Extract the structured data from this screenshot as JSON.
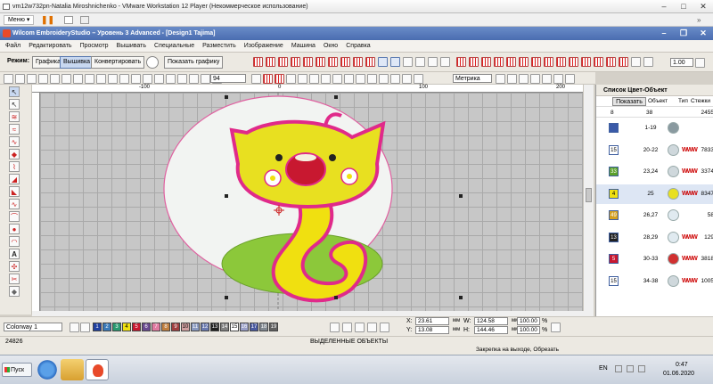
{
  "vm_window": {
    "title": "vm12w732pn-Natalia Miroshnichenko - VMware Workstation 12 Player (Некоммерческое использование)",
    "menu_label": "Меню"
  },
  "app": {
    "title": "Wilcom EmbroideryStudio – Уровень 3 Advanced - [Design1        Tajima]"
  },
  "menu": [
    "Файл",
    "Редактировать",
    "Просмотр",
    "Вышивать",
    "Специальные",
    "Разместить",
    "Изображение",
    "Машина",
    "Окно",
    "Справка"
  ],
  "toolbar1": {
    "mode_label": "Режим:",
    "graphics": "Графика",
    "embroidery": "Вышивка",
    "convert": "Конвертировать",
    "show_graphics": "Показать графику",
    "zoom_value": "1.00"
  },
  "toolbar2": {
    "stitch_value": "94",
    "units": "Метрика"
  },
  "ruler": {
    "labels": [
      "-100",
      "0",
      "100",
      "200"
    ]
  },
  "panel": {
    "title": "Список Цвет-Объект",
    "show_button": "Показать",
    "col_object": "Объект",
    "col_type": "Тип",
    "col_stitches": "Стежки",
    "summary": {
      "colors": "8",
      "objects": "38",
      "stitches": "2455"
    },
    "rows": [
      {
        "num": "",
        "range": "1-19",
        "obj_color": "#8a9aa0",
        "type": "",
        "stitches": "",
        "swatch": "#3a5aa8"
      },
      {
        "num": "15",
        "range": "20-22",
        "obj_color": "#cfd8dc",
        "type": "WWW",
        "stitches": "7833",
        "swatch": "#ffffff"
      },
      {
        "num": "33",
        "range": "23,24",
        "obj_color": "#cfd8dc",
        "type": "WWW",
        "stitches": "3374",
        "swatch": "#5aa02a"
      },
      {
        "num": "4",
        "range": "25",
        "obj_color": "#e8e020",
        "type": "WWW",
        "stitches": "8347",
        "swatch": "#f0e010"
      },
      {
        "num": "49",
        "range": "26,27",
        "obj_color": "#e0eaf0",
        "type": "",
        "stitches": "58",
        "swatch": "#d4a020"
      },
      {
        "num": "13",
        "range": "28,29",
        "obj_color": "#e0eaf0",
        "type": "WWW",
        "stitches": "129",
        "swatch": "#202020"
      },
      {
        "num": "5",
        "range": "30-33",
        "obj_color": "#d03030",
        "type": "WWW",
        "stitches": "3818",
        "swatch": "#c81830"
      },
      {
        "num": "15",
        "range": "34-38",
        "obj_color": "#cfd8dc",
        "type": "WWW",
        "stitches": "1005",
        "swatch": "#ffffff"
      }
    ]
  },
  "colorbar": {
    "colorway": "Colorway 1",
    "swatches": [
      {
        "n": "1",
        "c": "#2040a0"
      },
      {
        "n": "2",
        "c": "#3a7ab8"
      },
      {
        "n": "3",
        "c": "#2a9a70"
      },
      {
        "n": "4",
        "c": "#f0e010"
      },
      {
        "n": "5",
        "c": "#c81830"
      },
      {
        "n": "6",
        "c": "#6a4a90"
      },
      {
        "n": "7",
        "c": "#e07aa0"
      },
      {
        "n": "8",
        "c": "#c08040"
      },
      {
        "n": "9",
        "c": "#a04040"
      },
      {
        "n": "10",
        "c": "#d0a0a0"
      },
      {
        "n": "11",
        "c": "#8a9ac0"
      },
      {
        "n": "12",
        "c": "#6a7ab0"
      },
      {
        "n": "13",
        "c": "#202020"
      },
      {
        "n": "14",
        "c": "#808080"
      },
      {
        "n": "15",
        "c": "#ffffff"
      },
      {
        "n": "16",
        "c": "#9aa0c8"
      },
      {
        "n": "17",
        "c": "#4a5aa0"
      },
      {
        "n": "18",
        "c": "#808890"
      },
      {
        "n": "19",
        "c": "#606060"
      }
    ],
    "x_label": "X:",
    "x": "23.61",
    "y_label": "Y:",
    "y": "13.08",
    "w_label": "W:",
    "w": "124.58",
    "h_label": "H:",
    "h": "144.46",
    "unit": "мм",
    "pw": "100.00",
    "ph": "100.00",
    "pct": "%"
  },
  "status": {
    "stitch_count": "24826",
    "selected": "ВЫДЕЛЕННЫЕ ОБЪЕКТЫ",
    "hint": "Закрепка на выходе, Обрезать"
  },
  "taskbar": {
    "start": "Пуск",
    "lang": "EN",
    "time": "0:47",
    "date": "01.06.2020"
  }
}
